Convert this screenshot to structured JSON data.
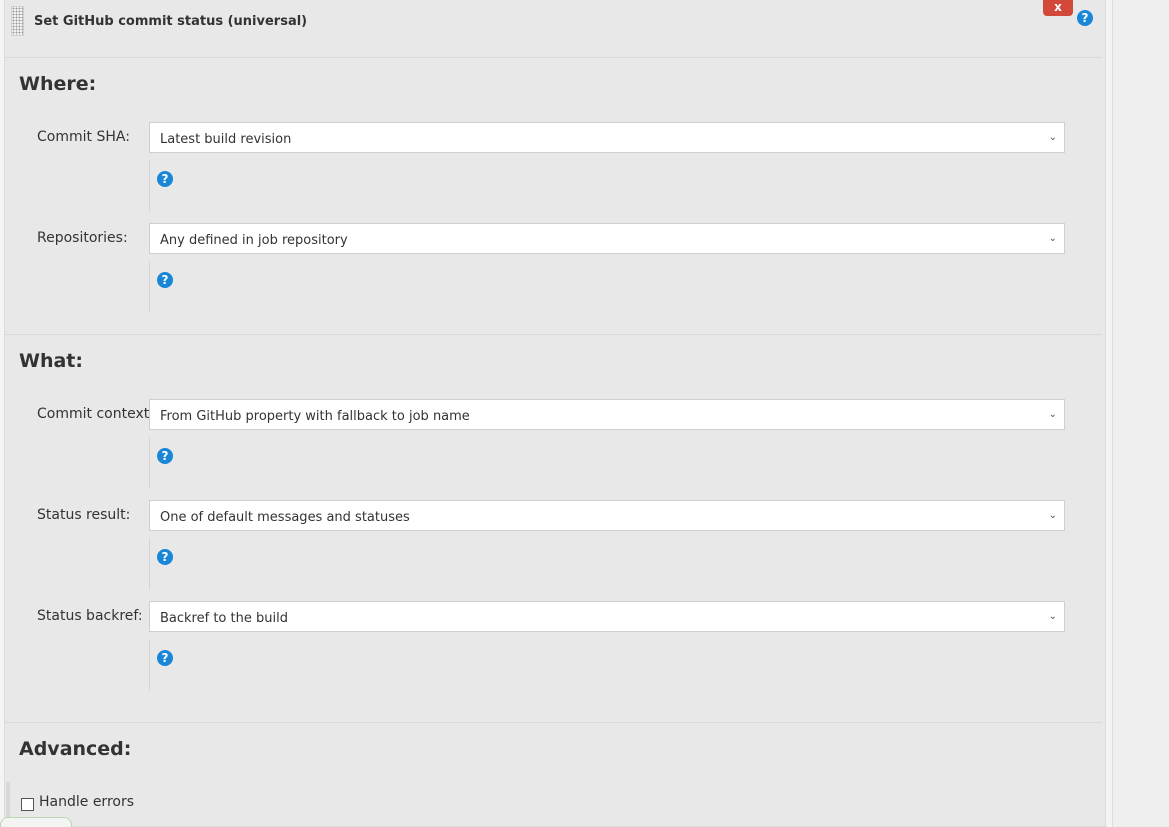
{
  "step": {
    "title": "Set GitHub commit status (universal)",
    "delete_label": "x",
    "help_glyph": "?"
  },
  "sections": {
    "where": {
      "heading": "Where:",
      "commit_sha": {
        "label": "Commit SHA:",
        "value": "Latest build revision"
      },
      "repositories": {
        "label": "Repositories:",
        "value": "Any defined in job repository"
      }
    },
    "what": {
      "heading": "What:",
      "commit_context": {
        "label": "Commit context:",
        "value": "From GitHub property with fallback to job name"
      },
      "status_result": {
        "label": "Status result:",
        "value": "One of default messages and statuses"
      },
      "status_backref": {
        "label": "Status backref:",
        "value": "Backref to the build"
      }
    },
    "advanced": {
      "heading": "Advanced:",
      "handle_errors": {
        "label": "Handle errors",
        "checked": false
      }
    }
  },
  "icons": {
    "help": "help-icon",
    "dropdown": "chevron-down-icon",
    "drag": "drag-handle-icon"
  },
  "colors": {
    "help_blue": "#1a86d8",
    "delete_red": "#d24939",
    "panel_bg": "#e8e8e8"
  }
}
